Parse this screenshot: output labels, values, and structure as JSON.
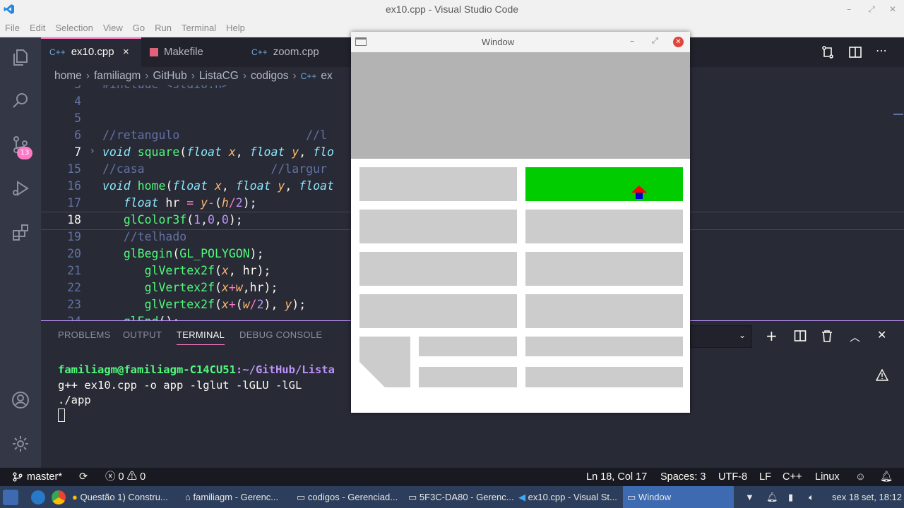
{
  "window_title": "ex10.cpp - Visual Studio Code",
  "menu": [
    "File",
    "Edit",
    "Selection",
    "View",
    "Go",
    "Run",
    "Terminal",
    "Help"
  ],
  "activity": {
    "source_control_badge": "13"
  },
  "tabs": [
    {
      "label": "ex10.cpp",
      "icon": "C++",
      "active": true,
      "close": "×"
    },
    {
      "label": "Makefile",
      "icon": "makefile-icon",
      "active": false
    },
    {
      "label": "zoom.cpp",
      "icon": "C++",
      "active": false
    }
  ],
  "breadcrumb": [
    "home",
    "familiagm",
    "GitHub",
    "ListaCG",
    "codigos",
    "ex"
  ],
  "editor": {
    "lines": [
      {
        "n": "3",
        "text": "#include <stdio.h>"
      },
      {
        "n": "4",
        "text": ""
      },
      {
        "n": "5",
        "text": ""
      },
      {
        "n": "6",
        "text": "//retangulo                  //l"
      },
      {
        "n": "7",
        "text": "void square(float x, float y, flo"
      },
      {
        "n": "15",
        "text": "//casa                  //largur"
      },
      {
        "n": "16",
        "text": "void home(float x, float y, float"
      },
      {
        "n": "17",
        "text": "   float hr = y-(h/2);"
      },
      {
        "n": "18",
        "text": "   glColor3f(1,0,0);"
      },
      {
        "n": "19",
        "text": "   //telhado"
      },
      {
        "n": "20",
        "text": "   glBegin(GL_POLYGON);"
      },
      {
        "n": "21",
        "text": "      glVertex2f(x, hr);"
      },
      {
        "n": "22",
        "text": "      glVertex2f(x+w,hr);"
      },
      {
        "n": "23",
        "text": "      glVertex2f(x+(w/2), y);"
      },
      {
        "n": "24",
        "text": "   glEnd();"
      }
    ]
  },
  "panel": {
    "tabs": [
      "PROBLEMS",
      "OUTPUT",
      "TERMINAL",
      "DEBUG CONSOLE"
    ],
    "active_tab": "TERMINAL",
    "terminal": {
      "prompt_user": "familiagm@familiagm-C14CU51",
      "prompt_path": ":~/GitHub/Lista",
      "lines": [
        "g++ ex10.cpp -o app -lglut -lGLU -lGL",
        "./app"
      ]
    }
  },
  "statusbar": {
    "branch": "master*",
    "errors": "0",
    "warnings": "0",
    "position": "Ln 18, Col 17",
    "spaces": "Spaces: 3",
    "encoding": "UTF-8",
    "eol": "LF",
    "language": "C++",
    "os": "Linux"
  },
  "gl_window": {
    "title": "Window",
    "colors": {
      "top_band": "#b3b3b3",
      "cell": "#cccccc",
      "highlight": "#00cc00",
      "roof": "#ff0000",
      "house": "#0000cc"
    }
  },
  "taskbar": {
    "items": [
      "Questão 1) Constru...",
      "familiagm - Gerenc...",
      "codigos - Gerenciad...",
      "5F3C-DA80 - Gerenc...",
      "ex10.cpp - Visual St...",
      "Window"
    ],
    "clock": "sex 18 set, 18:12"
  }
}
